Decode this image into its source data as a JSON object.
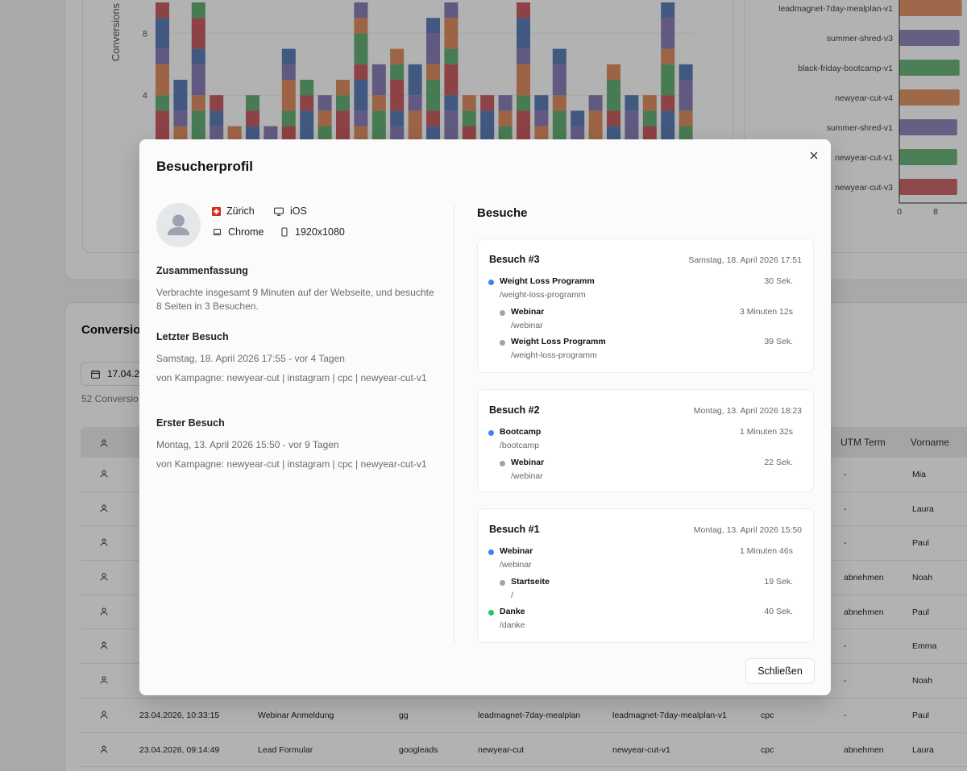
{
  "colors": {
    "blue": "#4c72b0",
    "orange": "#dd8452",
    "green": "#55a868",
    "red": "#c44e52",
    "purple": "#8172b3",
    "gray": "#9ca3af",
    "success": "#22c55e",
    "accent": "#3b82f6"
  },
  "chart_data": [
    {
      "type": "bar",
      "stacked": true,
      "ylabel": "Conversions",
      "yticks": [
        4,
        8
      ],
      "grid": true,
      "totals": [
        10,
        5,
        10,
        4,
        2,
        4,
        2,
        7,
        5,
        4,
        5,
        10,
        6,
        7,
        6,
        9,
        10,
        4,
        4,
        4,
        10,
        4,
        7,
        3,
        4,
        6,
        4,
        4,
        10,
        6
      ],
      "series_colors": [
        "#4c72b0",
        "#c44e52",
        "#55a868",
        "#dd8452",
        "#8172b3"
      ]
    },
    {
      "type": "bar",
      "orientation": "horizontal",
      "categories": [
        "leadmagnet-7day-mealplan-v1",
        "summer-shred-v3",
        "black-friday-bootcamp-v1",
        "newyear-cut-v4",
        "summer-shred-v1",
        "newyear-cut-v1",
        "newyear-cut-v3"
      ],
      "values": [
        12,
        11.5,
        11.5,
        11.5,
        11,
        11,
        11
      ],
      "colors": [
        "#dd8452",
        "#8172b3",
        "#55a868",
        "#dd8452",
        "#8172b3",
        "#55a868",
        "#c44e52"
      ],
      "xticks": [
        "0",
        "8"
      ]
    }
  ],
  "background": {
    "section_title": "Conversio",
    "date_value": "17.04.2",
    "count_text": "52 Conversio",
    "headers": {
      "utm_term": "UTM Term",
      "vorname": "Vorname"
    },
    "rows": [
      {
        "date": "",
        "form": "",
        "source": "",
        "campaign": "",
        "content": "",
        "medium": "",
        "term": "-",
        "name": "Mia"
      },
      {
        "date": "",
        "form": "",
        "source": "",
        "campaign": "",
        "content": "",
        "medium": "",
        "term": "-",
        "name": "Laura"
      },
      {
        "date": "",
        "form": "",
        "source": "",
        "campaign": "",
        "content": "",
        "medium": "",
        "term": "-",
        "name": "Paul"
      },
      {
        "date": "",
        "form": "",
        "source": "",
        "campaign": "",
        "content": "",
        "medium": "",
        "term": "abnehmen",
        "name": "Noah"
      },
      {
        "date": "",
        "form": "",
        "source": "",
        "campaign": "",
        "content": "",
        "medium": "",
        "term": "abnehmen",
        "name": "Paul"
      },
      {
        "date": "",
        "form": "",
        "source": "",
        "campaign": "",
        "content": "",
        "medium": "",
        "term": "-",
        "name": "Emma"
      },
      {
        "date": "",
        "form": "",
        "source": "",
        "campaign": "",
        "content": "",
        "medium": "",
        "term": "-",
        "name": "Noah"
      },
      {
        "date": "23.04.2026, 10:33:15",
        "form": "Webinar Anmeldung",
        "source": "gg",
        "campaign": "leadmagnet-7day-mealplan",
        "content": "leadmagnet-7day-mealplan-v1",
        "medium": "cpc",
        "term": "-",
        "name": "Paul"
      },
      {
        "date": "23.04.2026, 09:14:49",
        "form": "Lead Formular",
        "source": "googleads",
        "campaign": "newyear-cut",
        "content": "newyear-cut-v1",
        "medium": "cpc",
        "term": "abnehmen",
        "name": "Laura"
      }
    ]
  },
  "modal": {
    "title": "Besucherprofil",
    "location": "Zürich",
    "os": "iOS",
    "browser": "Chrome",
    "resolution": "1920x1080",
    "summary_label": "Zusammenfassung",
    "summary_text": "Verbrachte insgesamt 9 Minuten auf der Webseite, und besuchte 8 Seiten in 3 Besuchen.",
    "last_visit_label": "Letzter Besuch",
    "last_visit_date": "Samstag, 18. April 2026 17:55 - vor 4 Tagen",
    "last_visit_source": "von Kampagne: newyear-cut | instagram | cpc | newyear-cut-v1",
    "first_visit_label": "Erster Besuch",
    "first_visit_date": "Montag, 13. April 2026 15:50 - vor 9 Tagen",
    "first_visit_source": "von Kampagne: newyear-cut | instagram | cpc | newyear-cut-v1",
    "visits_title": "Besuche",
    "close_label": "Schließen",
    "visits": [
      {
        "title": "Besuch #3",
        "date": "Samstag, 18. April 2026 17:51",
        "steps": [
          {
            "name": "Weight Loss Programm",
            "path": "/weight-loss-programm",
            "duration": "30 Sek.",
            "type": "entry"
          },
          {
            "name": "Webinar",
            "path": "/webinar",
            "duration": "3 Minuten 12s",
            "type": "page"
          },
          {
            "name": "Weight Loss Programm",
            "path": "/weight-loss-programm",
            "duration": "39 Sek.",
            "type": "page"
          }
        ]
      },
      {
        "title": "Besuch #2",
        "date": "Montag, 13. April 2026 18:23",
        "steps": [
          {
            "name": "Bootcamp",
            "path": "/bootcamp",
            "duration": "1 Minuten 32s",
            "type": "entry"
          },
          {
            "name": "Webinar",
            "path": "/webinar",
            "duration": "22 Sek.",
            "type": "page"
          }
        ]
      },
      {
        "title": "Besuch #1",
        "date": "Montag, 13. April 2026 15:50",
        "steps": [
          {
            "name": "Webinar",
            "path": "/webinar",
            "duration": "1 Minuten 46s",
            "type": "entry"
          },
          {
            "name": "Startseite",
            "path": "/",
            "duration": "19 Sek.",
            "type": "page"
          },
          {
            "name": "Danke",
            "path": "/danke",
            "duration": "40 Sek.",
            "type": "conversion"
          }
        ]
      }
    ]
  }
}
